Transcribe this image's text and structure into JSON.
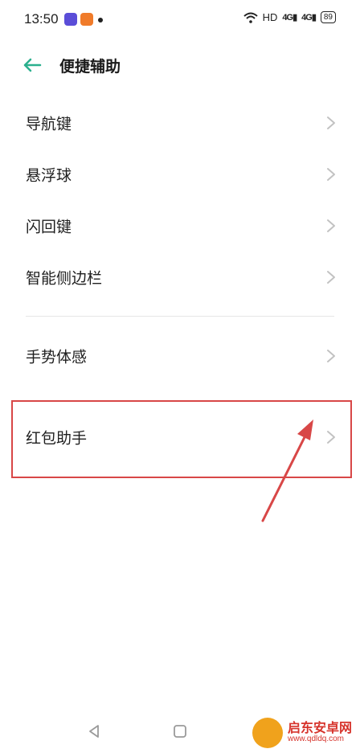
{
  "status_bar": {
    "time": "13:50",
    "network": "HD",
    "signal1": "4G",
    "signal2": "4G",
    "battery": "89"
  },
  "header": {
    "title": "便捷辅助"
  },
  "items": [
    {
      "label": "导航键"
    },
    {
      "label": "悬浮球"
    },
    {
      "label": "闪回键"
    },
    {
      "label": "智能侧边栏"
    },
    {
      "label": "手势体感"
    },
    {
      "label": "红包助手"
    }
  ],
  "watermark": {
    "text": "启东安卓网",
    "url": "www.qdldq.com"
  },
  "colors": {
    "accent": "#2bb08e",
    "highlight": "#d84747"
  }
}
